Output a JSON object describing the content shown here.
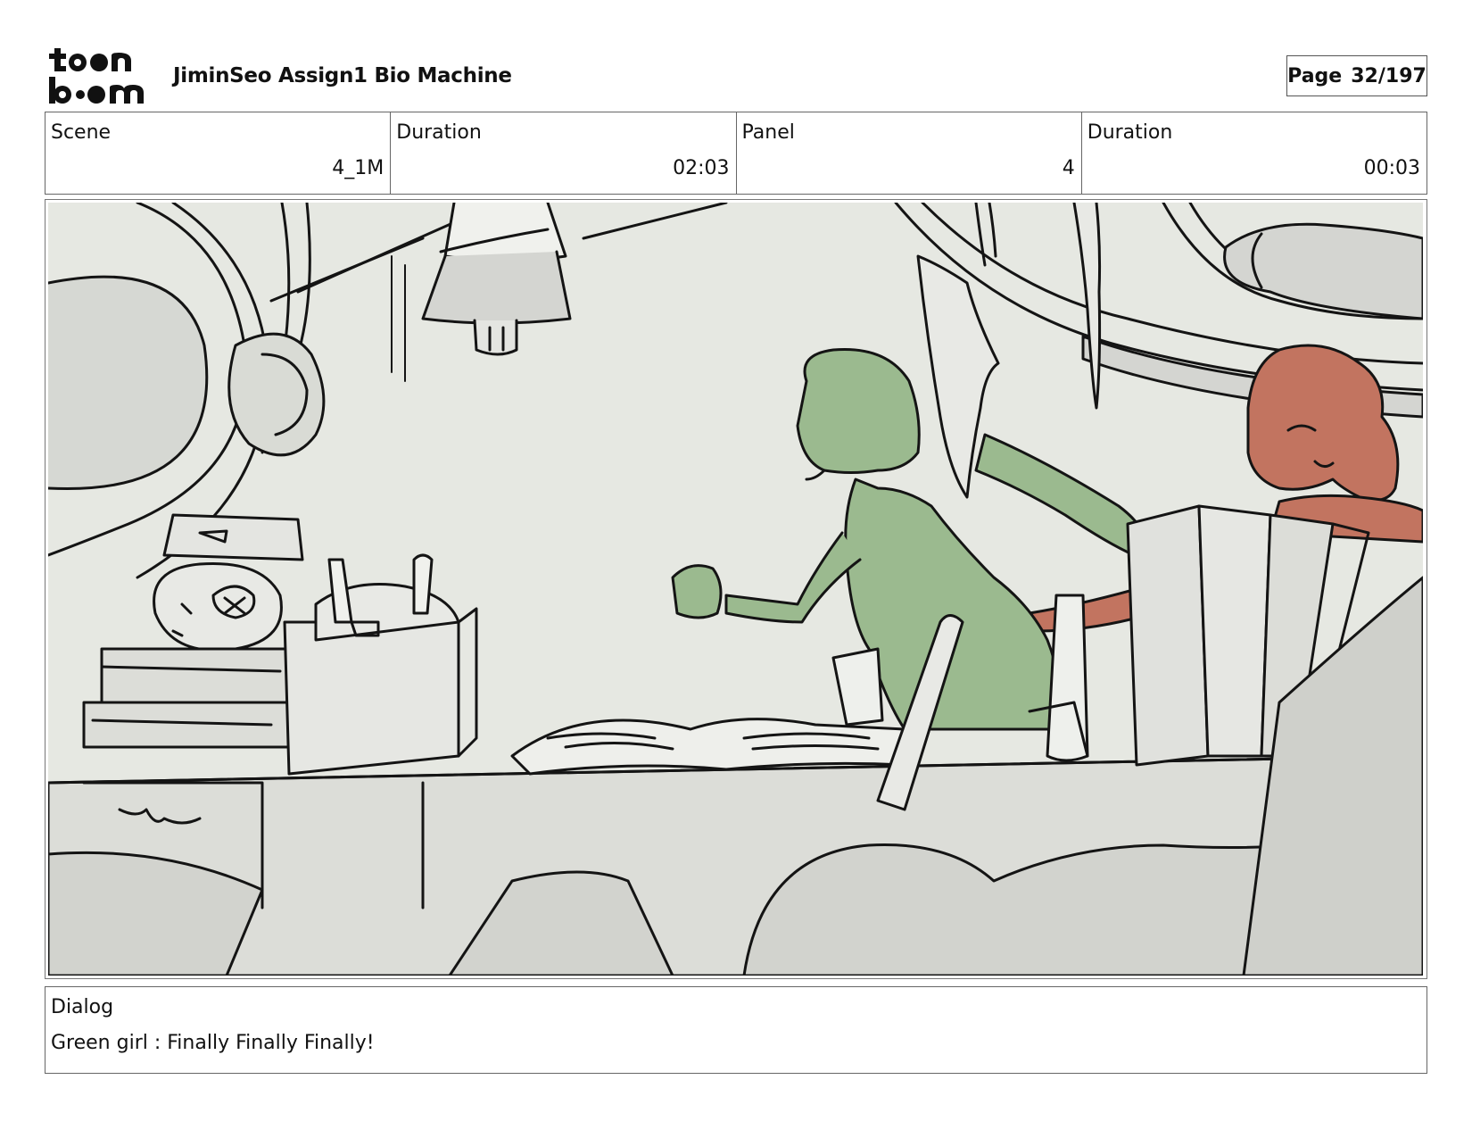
{
  "header": {
    "logo_text": "toon boom",
    "project_title": "JiminSeo Assign1 Bio Machine",
    "page_label": "Page",
    "page_number": "32/197"
  },
  "info": {
    "scene_label": "Scene",
    "scene_value": "4_1M",
    "scene_duration_label": "Duration",
    "scene_duration_value": "02:03",
    "panel_label": "Panel",
    "panel_value": "4",
    "panel_duration_label": "Duration",
    "panel_duration_value": "00:03"
  },
  "dialog": {
    "label": "Dialog",
    "text": "Green girl : Finally Finally Finally!"
  },
  "colors": {
    "background_panel": "#e6e8e2",
    "green_character": "#9bba8f",
    "red_character": "#c27460",
    "lineart": "#141414"
  }
}
